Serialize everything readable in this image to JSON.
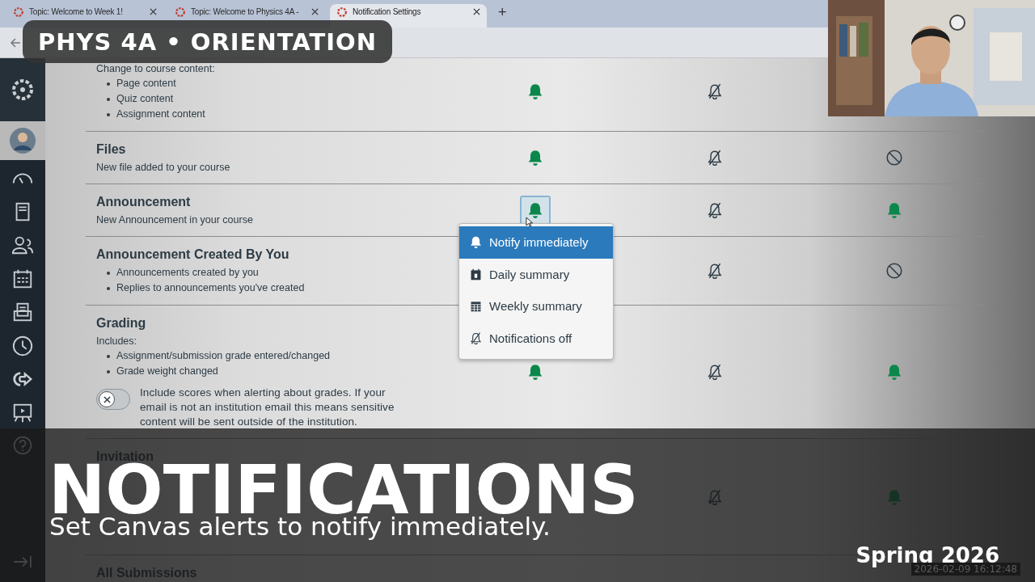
{
  "browser": {
    "tabs": [
      {
        "title": "Topic: Welcome to Week 1!",
        "selected": false
      },
      {
        "title": "Topic: Welcome to Physics 4A -",
        "selected": false
      },
      {
        "title": "Notification Settings",
        "selected": true
      }
    ],
    "new_tab": "+"
  },
  "badge": "PHYS 4A • ORIENTATION",
  "categories": [
    {
      "intro": "Change to course content:",
      "bullets": [
        "Page content",
        "Quiz content",
        "Assignment content"
      ],
      "cells": [
        {
          "kind": "bell",
          "focused": false
        },
        {
          "kind": "bell-off",
          "focused": false
        },
        null
      ]
    },
    {
      "title": "Files",
      "description": "New file added to your course",
      "cells": [
        {
          "kind": "bell",
          "focused": false
        },
        {
          "kind": "bell-off",
          "focused": false
        },
        {
          "kind": "blocked",
          "focused": false
        }
      ]
    },
    {
      "title": "Announcement",
      "description": "New Announcement in your course",
      "cells": [
        {
          "kind": "bell",
          "focused": true
        },
        {
          "kind": "bell-off",
          "focused": false
        },
        {
          "kind": "bell",
          "focused": false
        }
      ]
    },
    {
      "title": "Announcement Created By You",
      "bullets": [
        "Announcements created by you",
        "Replies to announcements you've created"
      ],
      "cells": [
        null,
        {
          "kind": "bell-off",
          "focused": false
        },
        {
          "kind": "blocked",
          "focused": false
        }
      ]
    },
    {
      "title": "Grading",
      "intro": "Includes:",
      "bullets": [
        "Assignment/submission grade entered/changed",
        "Grade weight changed"
      ],
      "toggle": {
        "on": false,
        "label": "Include scores when alerting about grades. If your email is not an institution email this means sensitive content will be sent outside of the institution."
      },
      "cells": [
        {
          "kind": "bell",
          "focused": false
        },
        {
          "kind": "bell-off",
          "focused": false
        },
        {
          "kind": "bell",
          "focused": false
        }
      ]
    },
    {
      "title": "Invitation",
      "cells": [
        null,
        {
          "kind": "bell-off",
          "focused": false
        },
        {
          "kind": "bell",
          "focused": false
        }
      ]
    },
    {
      "title": "All Submissions",
      "cells": [
        null,
        null,
        null
      ]
    }
  ],
  "menu": {
    "items": [
      {
        "label": "Notify immediately",
        "kind": "immediately",
        "selected": true
      },
      {
        "label": "Daily summary",
        "kind": "daily",
        "selected": false
      },
      {
        "label": "Weekly summary",
        "kind": "weekly",
        "selected": false
      },
      {
        "label": "Notifications off",
        "kind": "off",
        "selected": false
      }
    ]
  },
  "caption": {
    "title": "NOTIFICATIONS",
    "subtitle": "Set Canvas alerts to notify immediately.",
    "term": "Spring 2026",
    "timestamp": "2026-02-09 16:12:48"
  }
}
